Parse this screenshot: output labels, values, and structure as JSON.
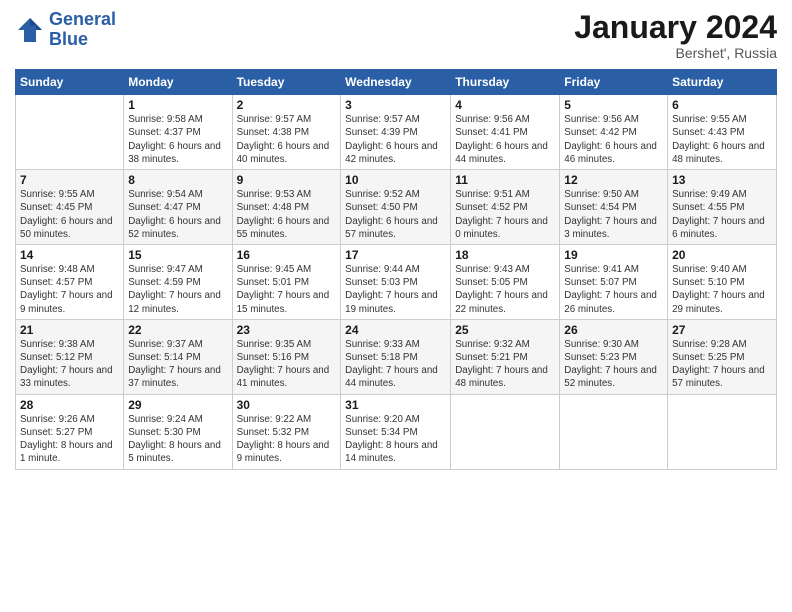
{
  "logo": {
    "line1": "General",
    "line2": "Blue"
  },
  "title": "January 2024",
  "subtitle": "Bershet', Russia",
  "days_of_week": [
    "Sunday",
    "Monday",
    "Tuesday",
    "Wednesday",
    "Thursday",
    "Friday",
    "Saturday"
  ],
  "weeks": [
    [
      {
        "num": "",
        "sunrise": "",
        "sunset": "",
        "daylight": ""
      },
      {
        "num": "1",
        "sunrise": "Sunrise: 9:58 AM",
        "sunset": "Sunset: 4:37 PM",
        "daylight": "Daylight: 6 hours and 38 minutes."
      },
      {
        "num": "2",
        "sunrise": "Sunrise: 9:57 AM",
        "sunset": "Sunset: 4:38 PM",
        "daylight": "Daylight: 6 hours and 40 minutes."
      },
      {
        "num": "3",
        "sunrise": "Sunrise: 9:57 AM",
        "sunset": "Sunset: 4:39 PM",
        "daylight": "Daylight: 6 hours and 42 minutes."
      },
      {
        "num": "4",
        "sunrise": "Sunrise: 9:56 AM",
        "sunset": "Sunset: 4:41 PM",
        "daylight": "Daylight: 6 hours and 44 minutes."
      },
      {
        "num": "5",
        "sunrise": "Sunrise: 9:56 AM",
        "sunset": "Sunset: 4:42 PM",
        "daylight": "Daylight: 6 hours and 46 minutes."
      },
      {
        "num": "6",
        "sunrise": "Sunrise: 9:55 AM",
        "sunset": "Sunset: 4:43 PM",
        "daylight": "Daylight: 6 hours and 48 minutes."
      }
    ],
    [
      {
        "num": "7",
        "sunrise": "Sunrise: 9:55 AM",
        "sunset": "Sunset: 4:45 PM",
        "daylight": "Daylight: 6 hours and 50 minutes."
      },
      {
        "num": "8",
        "sunrise": "Sunrise: 9:54 AM",
        "sunset": "Sunset: 4:47 PM",
        "daylight": "Daylight: 6 hours and 52 minutes."
      },
      {
        "num": "9",
        "sunrise": "Sunrise: 9:53 AM",
        "sunset": "Sunset: 4:48 PM",
        "daylight": "Daylight: 6 hours and 55 minutes."
      },
      {
        "num": "10",
        "sunrise": "Sunrise: 9:52 AM",
        "sunset": "Sunset: 4:50 PM",
        "daylight": "Daylight: 6 hours and 57 minutes."
      },
      {
        "num": "11",
        "sunrise": "Sunrise: 9:51 AM",
        "sunset": "Sunset: 4:52 PM",
        "daylight": "Daylight: 7 hours and 0 minutes."
      },
      {
        "num": "12",
        "sunrise": "Sunrise: 9:50 AM",
        "sunset": "Sunset: 4:54 PM",
        "daylight": "Daylight: 7 hours and 3 minutes."
      },
      {
        "num": "13",
        "sunrise": "Sunrise: 9:49 AM",
        "sunset": "Sunset: 4:55 PM",
        "daylight": "Daylight: 7 hours and 6 minutes."
      }
    ],
    [
      {
        "num": "14",
        "sunrise": "Sunrise: 9:48 AM",
        "sunset": "Sunset: 4:57 PM",
        "daylight": "Daylight: 7 hours and 9 minutes."
      },
      {
        "num": "15",
        "sunrise": "Sunrise: 9:47 AM",
        "sunset": "Sunset: 4:59 PM",
        "daylight": "Daylight: 7 hours and 12 minutes."
      },
      {
        "num": "16",
        "sunrise": "Sunrise: 9:45 AM",
        "sunset": "Sunset: 5:01 PM",
        "daylight": "Daylight: 7 hours and 15 minutes."
      },
      {
        "num": "17",
        "sunrise": "Sunrise: 9:44 AM",
        "sunset": "Sunset: 5:03 PM",
        "daylight": "Daylight: 7 hours and 19 minutes."
      },
      {
        "num": "18",
        "sunrise": "Sunrise: 9:43 AM",
        "sunset": "Sunset: 5:05 PM",
        "daylight": "Daylight: 7 hours and 22 minutes."
      },
      {
        "num": "19",
        "sunrise": "Sunrise: 9:41 AM",
        "sunset": "Sunset: 5:07 PM",
        "daylight": "Daylight: 7 hours and 26 minutes."
      },
      {
        "num": "20",
        "sunrise": "Sunrise: 9:40 AM",
        "sunset": "Sunset: 5:10 PM",
        "daylight": "Daylight: 7 hours and 29 minutes."
      }
    ],
    [
      {
        "num": "21",
        "sunrise": "Sunrise: 9:38 AM",
        "sunset": "Sunset: 5:12 PM",
        "daylight": "Daylight: 7 hours and 33 minutes."
      },
      {
        "num": "22",
        "sunrise": "Sunrise: 9:37 AM",
        "sunset": "Sunset: 5:14 PM",
        "daylight": "Daylight: 7 hours and 37 minutes."
      },
      {
        "num": "23",
        "sunrise": "Sunrise: 9:35 AM",
        "sunset": "Sunset: 5:16 PM",
        "daylight": "Daylight: 7 hours and 41 minutes."
      },
      {
        "num": "24",
        "sunrise": "Sunrise: 9:33 AM",
        "sunset": "Sunset: 5:18 PM",
        "daylight": "Daylight: 7 hours and 44 minutes."
      },
      {
        "num": "25",
        "sunrise": "Sunrise: 9:32 AM",
        "sunset": "Sunset: 5:21 PM",
        "daylight": "Daylight: 7 hours and 48 minutes."
      },
      {
        "num": "26",
        "sunrise": "Sunrise: 9:30 AM",
        "sunset": "Sunset: 5:23 PM",
        "daylight": "Daylight: 7 hours and 52 minutes."
      },
      {
        "num": "27",
        "sunrise": "Sunrise: 9:28 AM",
        "sunset": "Sunset: 5:25 PM",
        "daylight": "Daylight: 7 hours and 57 minutes."
      }
    ],
    [
      {
        "num": "28",
        "sunrise": "Sunrise: 9:26 AM",
        "sunset": "Sunset: 5:27 PM",
        "daylight": "Daylight: 8 hours and 1 minute."
      },
      {
        "num": "29",
        "sunrise": "Sunrise: 9:24 AM",
        "sunset": "Sunset: 5:30 PM",
        "daylight": "Daylight: 8 hours and 5 minutes."
      },
      {
        "num": "30",
        "sunrise": "Sunrise: 9:22 AM",
        "sunset": "Sunset: 5:32 PM",
        "daylight": "Daylight: 8 hours and 9 minutes."
      },
      {
        "num": "31",
        "sunrise": "Sunrise: 9:20 AM",
        "sunset": "Sunset: 5:34 PM",
        "daylight": "Daylight: 8 hours and 14 minutes."
      },
      {
        "num": "",
        "sunrise": "",
        "sunset": "",
        "daylight": ""
      },
      {
        "num": "",
        "sunrise": "",
        "sunset": "",
        "daylight": ""
      },
      {
        "num": "",
        "sunrise": "",
        "sunset": "",
        "daylight": ""
      }
    ]
  ]
}
